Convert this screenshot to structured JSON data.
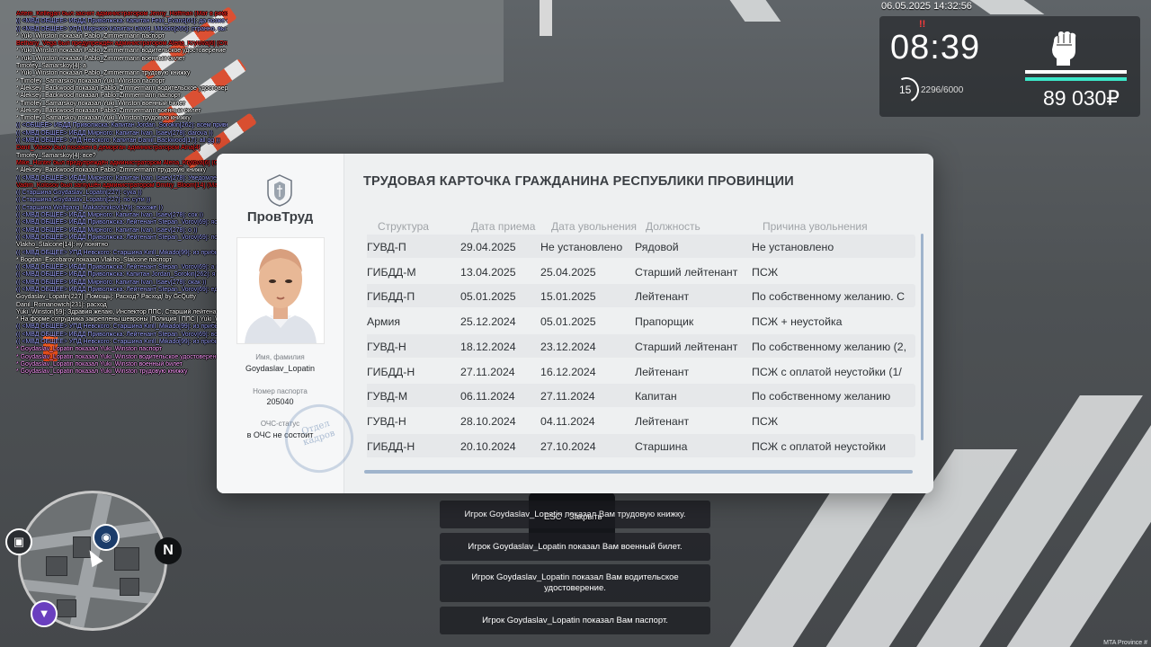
{
  "hud": {
    "date": "06.05.2025 14:32:56",
    "time": "08:39",
    "alert": "!!",
    "level": "15",
    "xp": "2296/6000",
    "money": "89 030₽",
    "fist_icon": "fist-icon"
  },
  "chat": [
    {
      "c": "red",
      "t": "Artem_Kellegari был заснят администратором Jenny_Hoffman (Мат в ремо)"
    },
    {
      "c": "blue",
      "t": "(( <МВД ОБЩЕЕ> ИБДД Приволжска: Капитан Felix_Evans[61]: да позже оказаться хотели водитель не так права ))"
    },
    {
      "c": "blue",
      "t": "(( <МВД ОБЩЕЕ> УПД Мирного Капитан David_Mikado[265]: странно, вы задержаться ))"
    },
    {
      "c": "white",
      "t": "* Yuki_Winston показал Pablo_Zimmermann паспорт"
    },
    {
      "c": "red",
      "t": "Bethany_Vega был предупреждён администратором Alena_Krylova[6] (Отыгровка)"
    },
    {
      "c": "white",
      "t": "* Yuki_Winston показал Pablo_Zimmermann водительское удостоверение"
    },
    {
      "c": "white",
      "t": "* Yuki_Winston показал Pablo_Zimmermann военный билет"
    },
    {
      "c": "white",
      "t": "Timofey_Samarskoy[4]: а"
    },
    {
      "c": "white",
      "t": "* Yuki_Winston показал Pablo_Zimmermann трудовую книжку"
    },
    {
      "c": "white",
      "t": "* Timofey_Samarskoy показал Yuki_Winston паспорт"
    },
    {
      "c": "white",
      "t": "* Aleksey_Backwood показал Pablo_Zimmermann водительское удостоверение"
    },
    {
      "c": "white",
      "t": "* Aleksey_Backwood показал Pablo_Zimmermann паспорт"
    },
    {
      "c": "white",
      "t": "* Timofey_Samarskoy показал Yuki_Winston военный билет"
    },
    {
      "c": "white",
      "t": "* Aleksey_Backwood показал Pablo_Zimmermann военный билет"
    },
    {
      "c": "white",
      "t": "* Timofey_Samarskoy показал Yuki_Winston трудовую книжку"
    },
    {
      "c": "blue",
      "t": "(( <ОБЩЕЕ> ИБДД Приволжска: Капитан Jordan_Sorokin[262]: всем приветики ))"
    },
    {
      "c": "blue",
      "t": "(( <МВД ОБЩЕЕ> ИБДД Мирного: Капитан Ivan_Isaev[278]: darova ))"
    },
    {
      "c": "blue",
      "t": "(( <МВД ОБЩЕЕ> УПД Невского: Капитан Daniil_Backwood[17]: all gg ))"
    },
    {
      "c": "red",
      "t": "Danil_Vlasov был посажен в деморган администратором Aina[4]"
    },
    {
      "c": "white",
      "t": "Timofey_Samarskoy[4]: все?"
    },
    {
      "c": "red",
      "t": "Mike_Hunter был предупреждён администратором Alena_Krylova[6] (Оскорбление)"
    },
    {
      "c": "white",
      "t": "* Aleksey_Backwood показал Pablo_Zimmermann трудовую книжку"
    },
    {
      "c": "blue",
      "t": "(( <МВД ОБЩЕЕ> ИБДД Мирного: Капитан Ivan_Isaev[278]: Уведомление: Номер Е188АМ 77 успешно присвоен для транспорта Lada Priora чего нормально ))"
    },
    {
      "c": "red",
      "t": "Vadim_Kolosov был заглушён администратором Dmitry_Bloom[14] (Мат в ООС)"
    },
    {
      "c": "blue",
      "t": "(( Старшина Goydaslav_Lopatin[227]: сука ))"
    },
    {
      "c": "blue",
      "t": "(( Старшина Goydaslav_Lopatin[227]: по сути ))"
    },
    {
      "c": "blue",
      "t": "(( Старшина Wolfgang_Makashnikov[179]: похоже ))"
    },
    {
      "c": "blue",
      "t": "(( <МВД ОБЩЕЕ> ИБДД Мирного: Капитан Ivan_Isaev[278]: сок ))"
    },
    {
      "c": "blue",
      "t": "(( <МВД ОБЩЕЕ> ИБДД Приволжска: Лейтенант Stepan_Vorov[69]: ясаве ))"
    },
    {
      "c": "blue",
      "t": "(( <МВД ОБЩЕЕ> ИБДД Мирного: Капитан Ivan_Isaev[278]: о ))"
    },
    {
      "c": "blue",
      "t": "(( <МВД ОБЩЕЕ> ИБДД Приволжска: Лейтенант Stepan_Vorov[69]: почему госсок нас5 ))"
    },
    {
      "c": "white",
      "t": "Vlakho_Stalcone[14]: ну понятно"
    },
    {
      "c": "blue",
      "t": "(( <МВД ОБЩЕЕ> УПД Невского: Старшина Kirill_Mikado[99]: из прибыли на вы он гп ))"
    },
    {
      "c": "white",
      "t": "* Bogdan_Escobarov показал Vlakho_Stalcone паспорт"
    },
    {
      "c": "blue",
      "t": "(( <МВД ОБЩЕЕ> ИБДД Приволжска: Лейтенант Stepan_Vorov[69]: а меня авто ))"
    },
    {
      "c": "blue",
      "t": "(( <МВД ОБЩЕЕ> ИБДД Приволжска: Капитан Jordan_Sorokin[262]: я так захотел ))"
    },
    {
      "c": "blue",
      "t": "(( <МВД ОБЩЕЕ> ИБДД Мирного: Капитан Ivan_Isaev[278]: окак ))"
    },
    {
      "c": "blue",
      "t": "(( <МВД ОБЩЕЕ> ИБДД Приволжска: Лейтенант Stepan_Vorov[69]: еду ночью ))"
    },
    {
      "c": "white",
      "t": "Goydaslav_Lopatin[227] [Помощь]: Расход? Расход! by GcQutty"
    },
    {
      "c": "white",
      "t": "Danil_Romanowich[231]: расход"
    },
    {
      "c": "white",
      "t": "Yuki_Winston[59]: Здравия желаю, Инспектор ППС, Старший лейтенант полиции Винстон, УПД по городу Приволжск."
    },
    {
      "c": "white",
      "t": "* На форме сотрудника закреплены шевроны [Полиция | ППС | Yuki_Winston]"
    },
    {
      "c": "blue",
      "t": "(( <МВД ОБЩЕЕ> УПД Невского: Старшина Kirill_Mikado[99]: из прибыли на вы он гп ))"
    },
    {
      "c": "blue",
      "t": "(( <МВД ОБЩЕЕ> ИБДД Приволжска: Лейтенант Stepan_Vorov[69]: все ))"
    },
    {
      "c": "blue",
      "t": "(( <МВД ОБЩЕЕ> УПД Невского: Старшина Kirill_Mikado[99]: из прибыли на вызов в dp ))"
    },
    {
      "c": "pink",
      "t": "* Goydaslav_Lopatin показал Yuki_Winston паспорт"
    },
    {
      "c": "pink",
      "t": "* Goydaslav_Lopatin показал Yuki_Winston водительское удостоверение"
    },
    {
      "c": "pink",
      "t": "* Goydaslav_Lopatin показал Yuki_Winston военный билет"
    },
    {
      "c": "pink",
      "t": "* Goydaslav_Lopatin показал Yuki_Winston трудовую книжку"
    }
  ],
  "card": {
    "brand": "ПровТруд",
    "title": "ТРУДОВАЯ КАРТОЧКА ГРАЖДАНИНА РЕСПУБЛИКИ ПРОВИНЦИИ",
    "name_label": "Имя, фамилия",
    "name_value": "Goydaslav_Lopatin",
    "passport_label": "Номер паспорта",
    "passport_value": "205040",
    "status_label": "ОЧС-статус",
    "status_value": "в ОЧС не состоит",
    "stamp_text": "Отдел кадров",
    "columns": [
      "Структура",
      "Дата приема",
      "Дата увольнения",
      "Должность",
      "Причина увольнения"
    ],
    "rows": [
      [
        "ГУВД-П",
        "29.04.2025",
        "Не установлено",
        "Рядовой",
        "Не установлено"
      ],
      [
        "ГИБДД-М",
        "13.04.2025",
        "25.04.2025",
        "Старший лейтенант",
        "ПСЖ"
      ],
      [
        "ГИБДД-П",
        "05.01.2025",
        "15.01.2025",
        "Лейтенант",
        "По собственному желанию. С"
      ],
      [
        "Армия",
        "25.12.2024",
        "05.01.2025",
        "Прапорщик",
        "ПСЖ + неустойка"
      ],
      [
        "ГУВД-Н",
        "18.12.2024",
        "23.12.2024",
        "Старший лейтенант",
        "По собственному желанию (2,"
      ],
      [
        "ГИБДД-Н",
        "27.11.2024",
        "16.12.2024",
        "Лейтенант",
        "ПСЖ с оплатой неустойки (1/"
      ],
      [
        "ГУВД-М",
        "06.11.2024",
        "27.11.2024",
        "Капитан",
        "По собственному желанию"
      ],
      [
        "ГУВД-Н",
        "28.10.2024",
        "04.11.2024",
        "Лейтенант",
        "ПСЖ"
      ],
      [
        "ГИБДД-Н",
        "20.10.2024",
        "27.10.2024",
        "Старшина",
        "ПСЖ с оплатой неустойки"
      ]
    ]
  },
  "notifications": [
    "Игрок Goydaslav_Lopatin показал Вам трудовую книжку.",
    "Игрок Goydaslav_Lopatin показал Вам военный билет.",
    "Игрок Goydaslav_Lopatin показал Вам водительское удостоверение.",
    "Игрок Goydaslav_Lopatin показал Вам паспорт."
  ],
  "esc_hint": "ESC · Закрыть",
  "minimap": {
    "north": "N"
  },
  "watermark": "MTA Province #"
}
